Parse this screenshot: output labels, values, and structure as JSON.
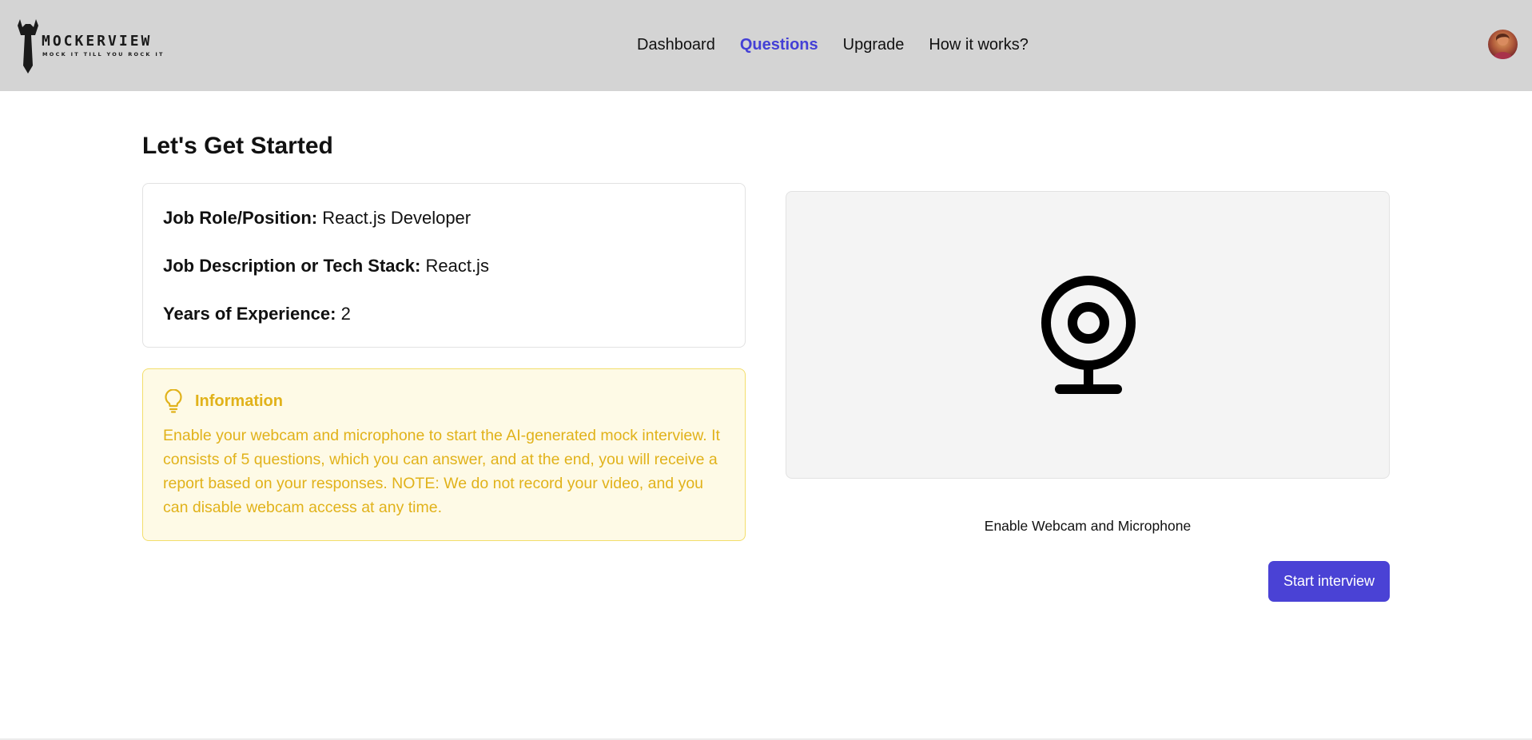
{
  "header": {
    "logo": {
      "name": "MOCKERVIEW",
      "tagline": "MOCK IT TILL YOU ROCK IT",
      "icon": "necktie-icon"
    },
    "nav": [
      {
        "label": "Dashboard",
        "active": false
      },
      {
        "label": "Questions",
        "active": true
      },
      {
        "label": "Upgrade",
        "active": false
      },
      {
        "label": "How it works?",
        "active": false
      }
    ],
    "avatar": "user-avatar"
  },
  "main": {
    "title": "Let's Get Started",
    "details": {
      "role_label": "Job Role/Position:",
      "role_value": "React.js Developer",
      "stack_label": "Job Description or Tech Stack:",
      "stack_value": "React.js",
      "experience_label": "Years of Experience:",
      "experience_value": "2"
    },
    "info": {
      "icon": "lightbulb-icon",
      "title": "Information",
      "text": "Enable your webcam and microphone to start the AI-generated mock interview. It consists of 5 questions, which you can answer, and at the end, you will receive a report based on your responses. NOTE: We do not record your video, and you can disable webcam access at any time."
    },
    "webcam": {
      "icon": "webcam-icon",
      "enable_label": "Enable Webcam and Microphone"
    },
    "start_button_label": "Start interview"
  },
  "colors": {
    "header_bg": "#d4d4d4",
    "accent": "#4a42d5",
    "info_bg": "#fefae6",
    "info_text": "#e1b21a"
  }
}
